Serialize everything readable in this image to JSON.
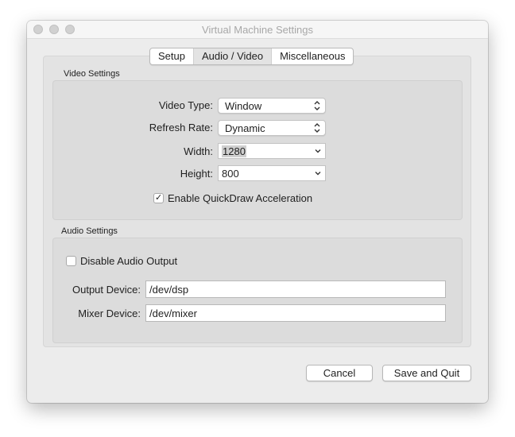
{
  "window": {
    "title": "Virtual Machine Settings"
  },
  "tabs": [
    {
      "label": "Setup",
      "selected": false
    },
    {
      "label": "Audio / Video",
      "selected": true
    },
    {
      "label": "Miscellaneous",
      "selected": false
    }
  ],
  "video": {
    "group_label": "Video Settings",
    "video_type": {
      "label": "Video Type:",
      "value": "Window"
    },
    "refresh_rate": {
      "label": "Refresh Rate:",
      "value": "Dynamic"
    },
    "width": {
      "label": "Width:",
      "value": "1280"
    },
    "height": {
      "label": "Height:",
      "value": "800"
    },
    "quickdraw": {
      "label": "Enable QuickDraw Acceleration",
      "checked": true
    }
  },
  "audio": {
    "group_label": "Audio Settings",
    "disable_output": {
      "label": "Disable Audio Output",
      "checked": false
    },
    "output_device": {
      "label": "Output Device:",
      "value": "/dev/dsp"
    },
    "mixer_device": {
      "label": "Mixer Device:",
      "value": "/dev/mixer"
    }
  },
  "buttons": {
    "cancel": "Cancel",
    "save": "Save and Quit"
  },
  "colors": {
    "window_bg": "#ececec",
    "group_bg": "#dcdcdc",
    "selected_tab": "#e3e3e3"
  }
}
